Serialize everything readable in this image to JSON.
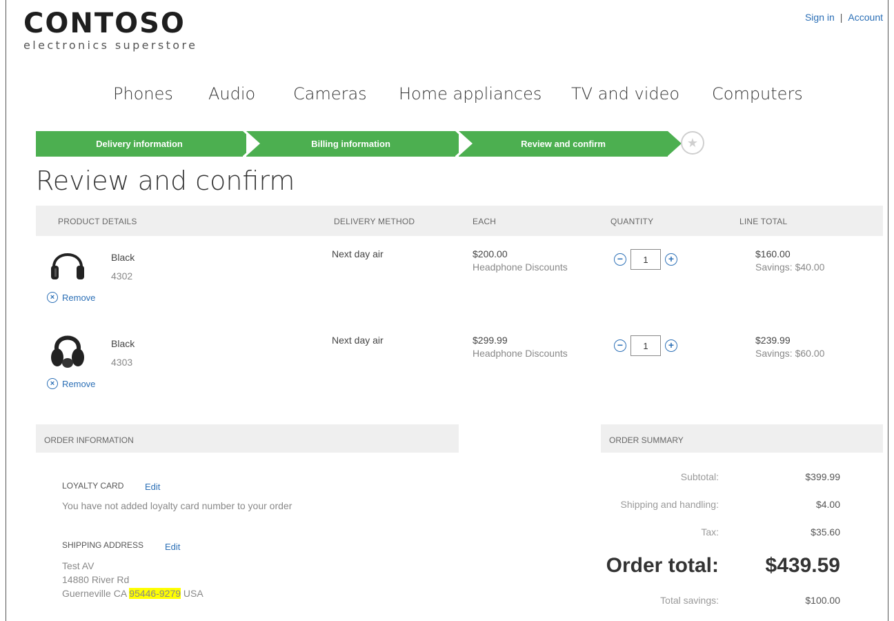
{
  "brand": {
    "name": "CONTOSO",
    "tagline": "electronics superstore"
  },
  "toplinks": {
    "sign_in": "Sign in",
    "separator": "|",
    "account": "Account"
  },
  "nav": [
    "Phones",
    "Audio",
    "Cameras",
    "Home appliances",
    "TV and video",
    "Computers"
  ],
  "steps": [
    "Delivery information",
    "Billing information",
    "Review and confirm"
  ],
  "page_title": "Review and confirm",
  "table": {
    "headers": [
      "PRODUCT DETAILS",
      "DELIVERY METHOD",
      "EACH",
      "QUANTITY",
      "LINE TOTAL"
    ],
    "rows": [
      {
        "attr": "Black",
        "sku": "4302",
        "remove": "Remove",
        "delivery": "Next day air",
        "price": "$200.00",
        "discount": "Headphone Discounts",
        "qty": "1",
        "line_total": "$160.00",
        "savings": "Savings: $40.00"
      },
      {
        "attr": "Black",
        "sku": "4303",
        "remove": "Remove",
        "delivery": "Next day air",
        "price": "$299.99",
        "discount": "Headphone Discounts",
        "qty": "1",
        "line_total": "$239.99",
        "savings": "Savings: $60.00"
      }
    ]
  },
  "order_info": {
    "header": "ORDER INFORMATION",
    "loyalty_label": "LOYALTY CARD",
    "loyalty_edit": "Edit",
    "loyalty_text": "You have not added loyalty card number to your order",
    "shipping_label": "SHIPPING ADDRESS",
    "shipping_edit": "Edit",
    "name": "Test AV",
    "street": "14880 River Rd",
    "city_state": "Guerneville CA",
    "zip": "95446-9279",
    "country": "USA"
  },
  "order_summary": {
    "header": "ORDER SUMMARY",
    "subtotal_label": "Subtotal:",
    "subtotal": "$399.99",
    "shipping_label": "Shipping and handling:",
    "shipping": "$4.00",
    "tax_label": "Tax:",
    "tax": "$35.60",
    "total_label": "Order total:",
    "total": "$439.59",
    "savings_label": "Total savings:",
    "savings": "$100.00"
  },
  "colors": {
    "step_green": "#4caf50",
    "link_blue": "#2b6fb6",
    "highlight": "#ffff00"
  },
  "icons": [
    "star-icon",
    "remove-icon",
    "minus-icon",
    "plus-icon",
    "headphones-icon"
  ]
}
